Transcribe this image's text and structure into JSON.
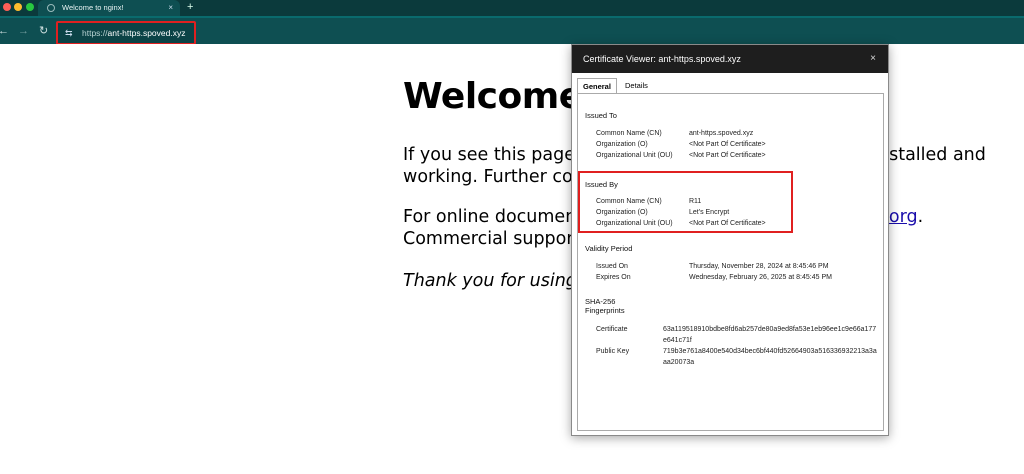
{
  "browser": {
    "tab_title": "Welcome to nginx!",
    "tab_close": "×",
    "new_tab": "+",
    "url_scheme": "https://",
    "url_host": "ant-https.spoved.xyz",
    "nav_back": "←",
    "nav_forward": "→",
    "nav_reload": "↻",
    "site_info": "⇆"
  },
  "page": {
    "heading": "Welcome",
    "p1_line1": "If you see this page,",
    "p1_line1_tail": "nstalled and",
    "p1_line2": "working. Further cor",
    "p2_line1": "For online document",
    "p2_link_tail": "x.org",
    "p2_line1_end": ".",
    "p2_line2": "Commercial support",
    "p3": "Thank you for using"
  },
  "dialog": {
    "title": "Certificate Viewer: ant-https.spoved.xyz",
    "close": "×",
    "tabs": [
      "General",
      "Details"
    ],
    "issued_to": {
      "title": "Issued To",
      "rows": [
        {
          "label": "Common Name (CN)",
          "value": "ant-https.spoved.xyz"
        },
        {
          "label": "Organization (O)",
          "value": "<Not Part Of Certificate>"
        },
        {
          "label": "Organizational Unit (OU)",
          "value": "<Not Part Of Certificate>"
        }
      ]
    },
    "issued_by": {
      "title": "Issued By",
      "rows": [
        {
          "label": "Common Name (CN)",
          "value": "R11"
        },
        {
          "label": "Organization (O)",
          "value": "Let's Encrypt"
        },
        {
          "label": "Organizational Unit (OU)",
          "value": "<Not Part Of Certificate>"
        }
      ]
    },
    "validity": {
      "title": "Validity Period",
      "rows": [
        {
          "label": "Issued On",
          "value": "Thursday, November 28, 2024 at 8:45:46 PM"
        },
        {
          "label": "Expires On",
          "value": "Wednesday, February 26, 2025 at 8:45:45 PM"
        }
      ]
    },
    "fingerprints": {
      "title_line1": "SHA-256",
      "title_line2": "Fingerprints",
      "rows": [
        {
          "label": "Certificate",
          "value": "63a119518910bdbe8fd6ab257de80a9ed8fa53e1eb96ee1c9e66a177e641c71f"
        },
        {
          "label": "Public Key",
          "value": "719b3e761a8400e540d34bec6bf440fd52664903a516336932213a3aaa20073a"
        }
      ]
    }
  },
  "colors": {
    "chrome_dark": "#0b3a3c",
    "chrome_toolbar": "#0e4f52",
    "highlight": "#e02020",
    "link": "#1a0dab"
  }
}
